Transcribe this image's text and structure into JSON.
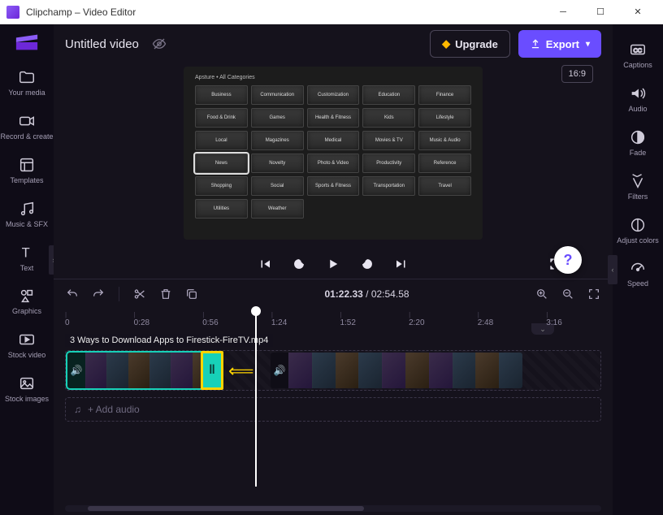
{
  "window": {
    "title": "Clipchamp – Video Editor"
  },
  "header": {
    "project_title": "Untitled video",
    "upgrade_label": "Upgrade",
    "export_label": "Export",
    "aspect_ratio": "16:9"
  },
  "left_rail": [
    {
      "icon": "folder-icon",
      "label": "Your media"
    },
    {
      "icon": "camera-icon",
      "label": "Record & create"
    },
    {
      "icon": "templates-icon",
      "label": "Templates"
    },
    {
      "icon": "music-icon",
      "label": "Music & SFX"
    },
    {
      "icon": "text-icon",
      "label": "Text"
    },
    {
      "icon": "graphics-icon",
      "label": "Graphics"
    },
    {
      "icon": "stock-video-icon",
      "label": "Stock video"
    },
    {
      "icon": "stock-images-icon",
      "label": "Stock images"
    }
  ],
  "right_rail": [
    {
      "icon": "captions-icon",
      "label": "Captions"
    },
    {
      "icon": "audio-icon",
      "label": "Audio"
    },
    {
      "icon": "fade-icon",
      "label": "Fade"
    },
    {
      "icon": "filters-icon",
      "label": "Filters"
    },
    {
      "icon": "adjust-colors-icon",
      "label": "Adjust colors"
    },
    {
      "icon": "speed-icon",
      "label": "Speed"
    }
  ],
  "preview": {
    "header_text": "Apsture • All Categories",
    "grid": [
      [
        "Business",
        "Communication",
        "Customization",
        "Education",
        "Finance"
      ],
      [
        "Food & Drink",
        "Games",
        "Health & Fitness",
        "Kids",
        "Lifestyle"
      ],
      [
        "Local",
        "Magazines",
        "Medical",
        "Movies & TV",
        "Music & Audio"
      ],
      [
        "News",
        "Novelty",
        "Photo & Video",
        "Productivity",
        "Reference"
      ],
      [
        "Shopping",
        "Social",
        "Sports & Fitness",
        "Transportation",
        "Travel"
      ],
      [
        "Utilities",
        "Weather"
      ]
    ],
    "selected_row": 3,
    "selected_col": 0
  },
  "playback": {
    "current_time": "01:22.33",
    "total_time": "02:54.58"
  },
  "ruler": {
    "ticks": [
      "0",
      "0:28",
      "0:56",
      "1:24",
      "1:52",
      "2:20",
      "2:48",
      "3:16"
    ]
  },
  "timeline": {
    "clip_label": "3 Ways to Download Apps to Firestick-FireTV.mp4",
    "add_audio_label": "+ Add audio"
  }
}
